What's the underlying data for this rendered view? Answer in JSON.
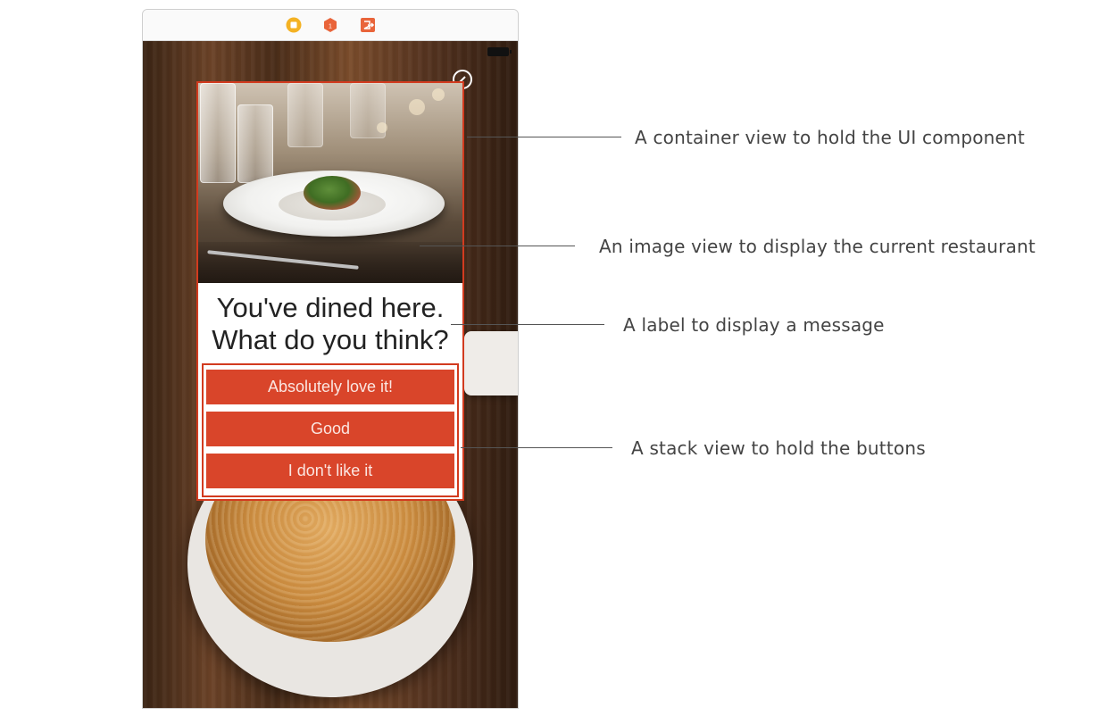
{
  "scene_bar": {
    "icons": [
      "view-controller-icon",
      "first-responder-icon",
      "exit-icon"
    ]
  },
  "prompt": {
    "line1": "You've dined here.",
    "line2": "What do you think?"
  },
  "buttons": [
    {
      "label": "Absolutely love it!"
    },
    {
      "label": "Good"
    },
    {
      "label": "I don't like it"
    }
  ],
  "annotations": {
    "container": "A container view to hold the UI component",
    "image": "An image view to display the current restaurant",
    "label": "A label to display a message",
    "stack": "A stack view to hold the buttons"
  },
  "colors": {
    "accent": "#d9452a",
    "outline": "#d23b1f",
    "toolbar_yellow": "#f4b223",
    "toolbar_orange": "#e9643a"
  }
}
